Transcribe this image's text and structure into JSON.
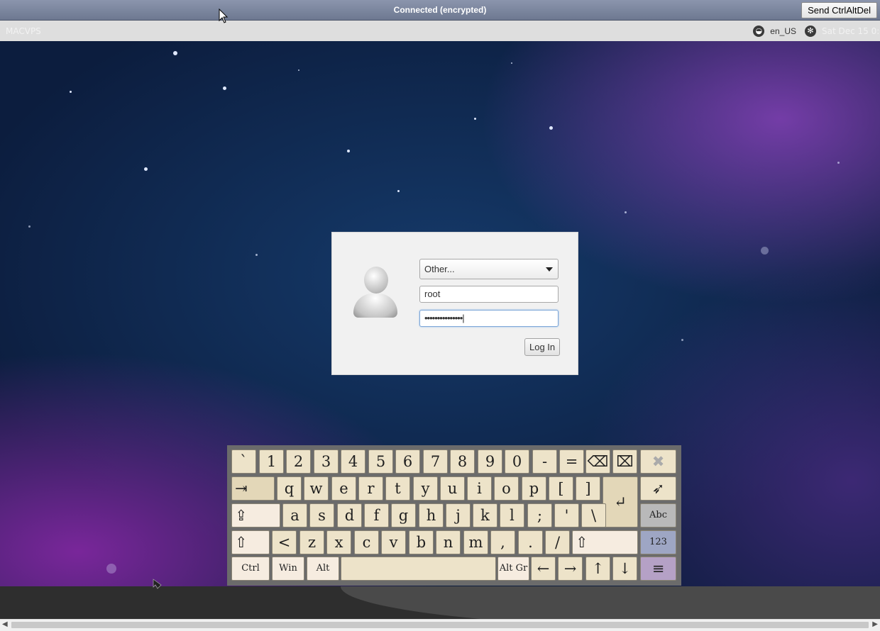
{
  "vnc": {
    "status": "Connected (encrypted)",
    "send_cad": "Send CtrlAltDel"
  },
  "panel": {
    "hostname": "MACVPS",
    "language": "en_US",
    "clock": "Sat Dec 15 0:"
  },
  "login": {
    "session": "Other...",
    "username": "root",
    "password": "•••••••••••••••|",
    "login_button": "Log In"
  },
  "keyboard": {
    "row1": [
      "`",
      "1",
      "2",
      "3",
      "4",
      "5",
      "6",
      "7",
      "8",
      "9",
      "0",
      "-",
      "="
    ],
    "row2": [
      "q",
      "w",
      "e",
      "r",
      "t",
      "y",
      "u",
      "i",
      "o",
      "p",
      "[",
      "]"
    ],
    "row3": [
      "a",
      "s",
      "d",
      "f",
      "g",
      "h",
      "j",
      "k",
      "l",
      ";",
      "'",
      "\\"
    ],
    "row4": [
      "<",
      "z",
      "x",
      "c",
      "v",
      "b",
      "n",
      "m",
      ",",
      ".",
      "/"
    ],
    "ctrl": "Ctrl",
    "win": "Win",
    "alt": "Alt",
    "altgr": "Alt Gr",
    "abc": "Abc",
    "num": "123",
    "tab_glyph": "⇥",
    "caps_glyph": "⇪",
    "shift_glyph": "⇧",
    "enter_glyph": "↵",
    "backspace_glyph": "⌫",
    "delete_glyph": "⌧",
    "close_glyph": "✖",
    "pointer_glyph": "➶",
    "menu_glyph": "≡",
    "left": "←",
    "right": "→",
    "up": "↑",
    "down": "↓"
  },
  "colors": {
    "accent": "#7ea7d8",
    "key_face": "#ede3c9",
    "panel": "#dedede"
  }
}
